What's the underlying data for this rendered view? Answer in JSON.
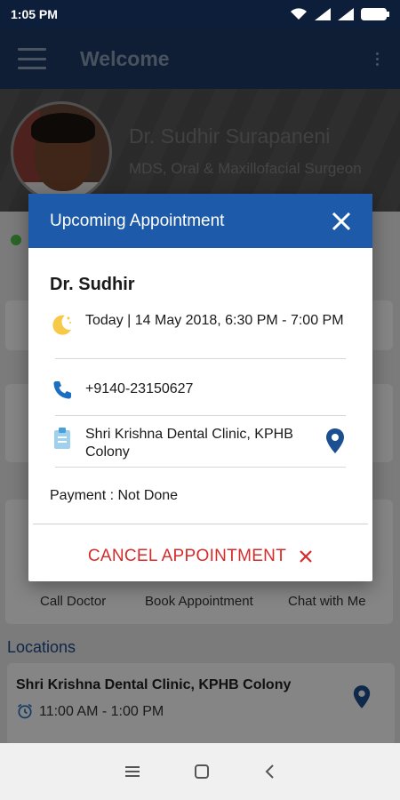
{
  "status": {
    "time": "1:05 PM"
  },
  "app_bar": {
    "title": "Welcome",
    "menu_icon": "hamburger-menu-icon",
    "overflow_icon": "more-vert-icon"
  },
  "profile": {
    "name": "Dr. Sudhir Surapaneni",
    "qualification": "MDS, Oral & Maxillofacial Surgeon"
  },
  "background": {
    "quick_actions": [
      "Call Doctor",
      "Book Appointment",
      "Chat with Me"
    ],
    "locations_heading": "Locations",
    "location": {
      "name": "Shri Krishna Dental Clinic, KPHB Colony",
      "time": "11:00 AM - 1:00 PM"
    }
  },
  "modal": {
    "title": "Upcoming Appointment",
    "doctor": "Dr. Sudhir",
    "datetime": "Today | 14 May 2018, 6:30 PM - 7:00 PM",
    "phone": "+9140-23150627",
    "clinic": "Shri Krishna Dental Clinic, KPHB Colony",
    "payment": "Payment : Not Done",
    "cancel_label": "CANCEL APPOINTMENT"
  },
  "colors": {
    "primary": "#1d5baa",
    "app_bar": "#1f3a66",
    "cancel": "#d62b2b",
    "icon_blue": "#1c6fc0",
    "moon": "#f7c948"
  }
}
